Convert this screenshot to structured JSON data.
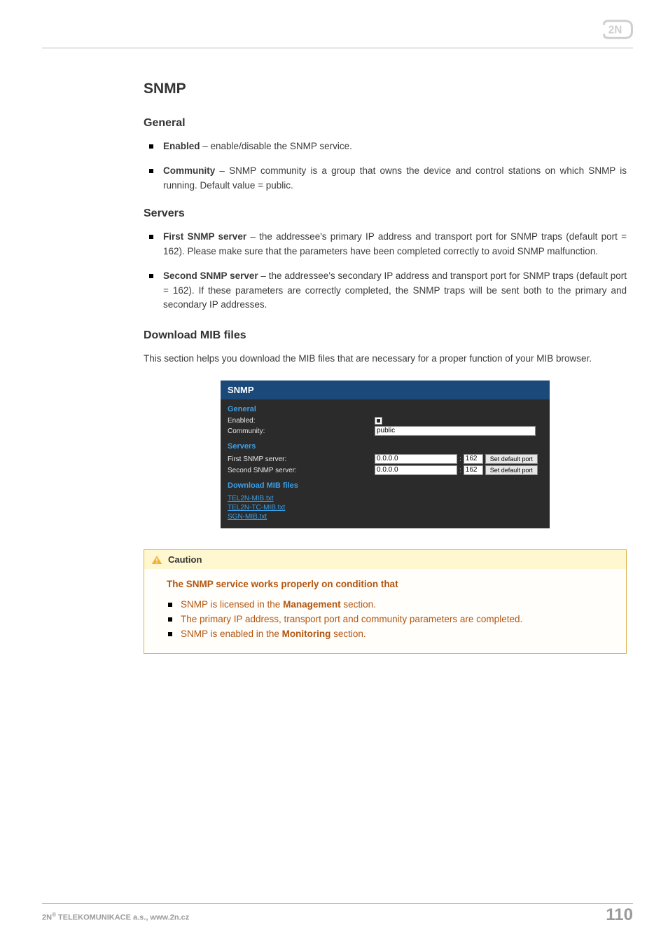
{
  "logo_text": "2N",
  "title": "SNMP",
  "general": {
    "heading": "General",
    "enabled": {
      "term": "Enabled",
      "desc": " – enable/disable the SNMP service."
    },
    "community": {
      "term": "Community",
      "desc": " –  SNMP community is a group that owns the device and control stations on which SNMP is running. Default value = public."
    }
  },
  "servers": {
    "heading": "Servers",
    "first": {
      "term": "First SNMP server",
      "desc": " – the addressee's primary IP address and transport port for SNMP traps (default port = 162). Please make sure that the parameters have been completed correctly to avoid SNMP malfunction."
    },
    "second": {
      "term": "Second SNMP server",
      "desc": " – the addressee's secondary IP address and transport port for SNMP traps (default port = 162). If these parameters are correctly completed, the SNMP traps will be sent both to the primary and secondary IP addresses."
    }
  },
  "mib": {
    "heading": "Download MIB files",
    "body": "This section helps you download the MIB files that are necessary for a proper function of your MIB browser."
  },
  "panel": {
    "title": "SNMP",
    "sec_general": "General",
    "lbl_enabled": "Enabled:",
    "lbl_community": "Community:",
    "val_community": "public",
    "sec_servers": "Servers",
    "lbl_first": "First SNMP server:",
    "lbl_second": "Second SNMP server:",
    "ip_default": "0.0.0.0",
    "port_default": "162",
    "colon": ":",
    "btn_default": "Set default port",
    "sec_download": "Download MIB files",
    "link1": "TEL2N-MIB.txt",
    "link2": "TEL2N-TC-MIB.txt",
    "link3": "SGN-MIB.txt"
  },
  "caution": {
    "heading": "Caution",
    "subheading": "The SNMP service works properly on condition that",
    "item1a": "SNMP is licensed in the ",
    "item1b": "Management",
    "item1c": " section.",
    "item2": "The primary IP address, transport port and community parameters are completed.",
    "item3a": "SNMP is enabled in the ",
    "item3b": "Monitoring",
    "item3c": " section."
  },
  "footer": {
    "brand_prefix": "2N",
    "brand_reg": "®",
    "brand_suffix": " TELEKOMUNIKACE a.s., www.2n.cz",
    "page": "110"
  }
}
